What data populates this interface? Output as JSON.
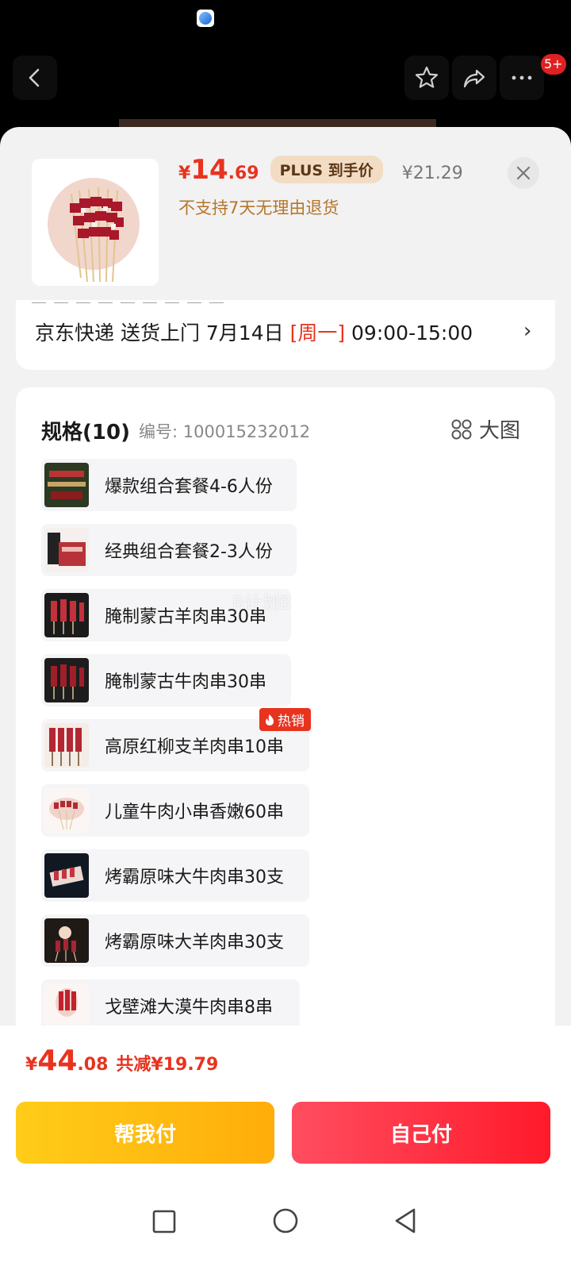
{
  "status": {
    "app_icon": "blue-app-icon"
  },
  "topbar": {
    "back_icon": "chevron-left-icon",
    "favorite_icon": "star-icon",
    "share_icon": "share-icon",
    "more_icon": "more-dots-icon",
    "more_badge": "5+"
  },
  "product": {
    "price_currency": "¥",
    "price_int": "14",
    "price_dec": ".69",
    "plus_tag": "PLUS 到手价",
    "original_price": "¥21.29",
    "notice": "不支持7天无理由退货"
  },
  "delivery": {
    "text_prefix": "京东快递 送货上门 7月14日 ",
    "weekday": "[周一]",
    "time": " 09:00-15:00",
    "arrow": "›"
  },
  "spec": {
    "title": "规格(10)",
    "sku_label": "编号: 100015232012",
    "big_view_label": "大图",
    "options": [
      {
        "label": "爆款组合套餐4-6人份"
      },
      {
        "label": "经典组合套餐2-3人份"
      },
      {
        "label": "腌制蒙古羊肉串30串"
      },
      {
        "label": "腌制蒙古牛肉串30串"
      },
      {
        "label": "高原红柳支羊肉串10串",
        "badge": "热销"
      },
      {
        "label": "儿童牛肉小串香嫩60串"
      },
      {
        "label": "烤霸原味大牛肉串30支"
      },
      {
        "label": "烤霸原味大羊肉串30支"
      },
      {
        "label": "戈壁滩大漠牛肉串8串"
      }
    ]
  },
  "watermark": "B计划B",
  "checkout": {
    "currency": "¥",
    "total_int": "44",
    "total_dec": ".08",
    "savings": "共减¥19.79",
    "pay_helper_label": "帮我付",
    "pay_self_label": "自己付"
  },
  "colors": {
    "accent": "#e8331f",
    "helper": "#ffb80f",
    "self": "#ff2a3a"
  }
}
